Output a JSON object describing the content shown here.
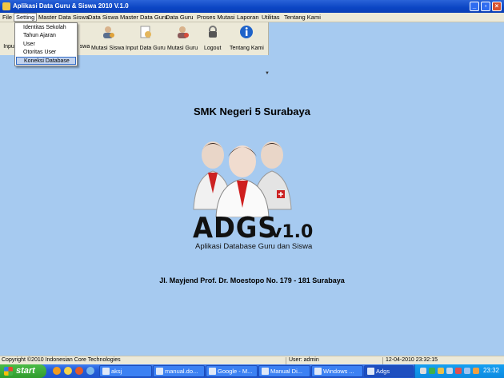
{
  "window": {
    "title": "Aplikasi Data Guru & Siswa 2010 V.1.0"
  },
  "menubar": [
    {
      "label": "File"
    },
    {
      "label": "Setting"
    },
    {
      "label": "Master Data Siswa"
    },
    {
      "label": "Data Siswa"
    },
    {
      "label": "Master Data Guru"
    },
    {
      "label": "Data Guru"
    },
    {
      "label": "Proses Mutasi"
    },
    {
      "label": "Laporan"
    },
    {
      "label": "Utilitas"
    },
    {
      "label": "Tentang Kami"
    }
  ],
  "setting_menu": {
    "items": [
      {
        "label": "Identitas Sekolah"
      },
      {
        "label": "Tahun Ajaran"
      },
      {
        "label": "User"
      },
      {
        "label": "Otoritas User"
      },
      {
        "label": "Koneksi Database"
      }
    ],
    "highlighted": "Koneksi Database"
  },
  "toolbar": {
    "items": [
      {
        "label": "Inpu",
        "icon": "input-siswa-icon"
      },
      {
        "label": "swa",
        "icon": "data-siswa-icon"
      },
      {
        "label": "Mutasi Siswa",
        "icon": "mutasi-siswa-icon"
      },
      {
        "label": "Input Data Guru",
        "icon": "input-guru-icon"
      },
      {
        "label": "Mutasi Guru",
        "icon": "mutasi-guru-icon"
      },
      {
        "label": "Logout",
        "icon": "lock-icon"
      },
      {
        "label": "Tentang Kami",
        "icon": "info-icon"
      }
    ]
  },
  "main": {
    "school_name": "SMK Negeri 5 Surabaya",
    "logo_text": "ADGS",
    "logo_version": "v1.0",
    "logo_subtitle": "Aplikasi Database Guru dan Siswa",
    "address": "Jl. Mayjend Prof. Dr. Moestopo No. 179 - 181 Surabaya"
  },
  "statusbar": {
    "copyright": "Copyright ©2010 Indonesian Core Technologies",
    "user": "User: admin",
    "datetime": "12-04-2010 23:32:15"
  },
  "taskbar": {
    "start_label": "start",
    "tasks": [
      {
        "label": "aksj"
      },
      {
        "label": "manual.do..."
      },
      {
        "label": "Google - M..."
      },
      {
        "label": "Manual Di..."
      },
      {
        "label": "Windows ..."
      },
      {
        "label": "Adgs"
      }
    ],
    "active_task": "Adgs",
    "clock": "23:32"
  },
  "colors": {
    "desktop_bg": "#a6caf0",
    "title_bar": "#0b45c4",
    "menu_highlight": "#c1d2ee"
  }
}
